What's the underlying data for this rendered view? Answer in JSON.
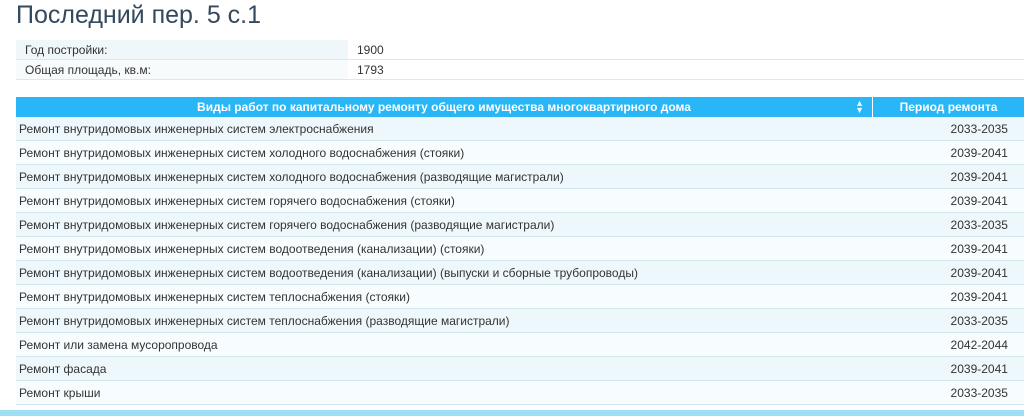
{
  "page": {
    "title": "Последний пер. 5 с.1"
  },
  "info": [
    {
      "label": "Год постройки:",
      "value": "1900"
    },
    {
      "label": "Общая площадь, кв.м:",
      "value": "1793"
    }
  ],
  "works_table": {
    "headers": {
      "work_type": "Виды работ по капитальному ремонту общего имущества многоквартирного дома",
      "period": "Период ремонта"
    },
    "rows": [
      {
        "name": "Ремонт внутридомовых инженерных систем электроснабжения",
        "period": "2033-2035"
      },
      {
        "name": "Ремонт внутридомовых инженерных систем холодного водоснабжения (стояки)",
        "period": "2039-2041"
      },
      {
        "name": "Ремонт внутридомовых инженерных систем холодного водоснабжения (разводящие магистрали)",
        "period": "2039-2041"
      },
      {
        "name": "Ремонт внутридомовых инженерных систем горячего водоснабжения (стояки)",
        "period": "2039-2041"
      },
      {
        "name": "Ремонт внутридомовых инженерных систем горячего водоснабжения (разводящие магистрали)",
        "period": "2033-2035"
      },
      {
        "name": "Ремонт внутридомовых инженерных систем водоотведения (канализации) (стояки)",
        "period": "2039-2041"
      },
      {
        "name": "Ремонт внутридомовых инженерных систем водоотведения (канализации) (выпуски и сборные трубопроводы)",
        "period": "2039-2041"
      },
      {
        "name": "Ремонт внутридомовых инженерных систем теплоснабжения (стояки)",
        "period": "2039-2041"
      },
      {
        "name": "Ремонт внутридомовых инженерных систем теплоснабжения (разводящие магистрали)",
        "period": "2033-2035"
      },
      {
        "name": "Ремонт или замена мусоропровода",
        "period": "2042-2044"
      },
      {
        "name": "Ремонт фасада",
        "period": "2039-2041"
      },
      {
        "name": "Ремонт крыши",
        "period": "2033-2035"
      }
    ]
  },
  "colors": {
    "header_bg": "#29b6f6",
    "title": "#34495e"
  }
}
